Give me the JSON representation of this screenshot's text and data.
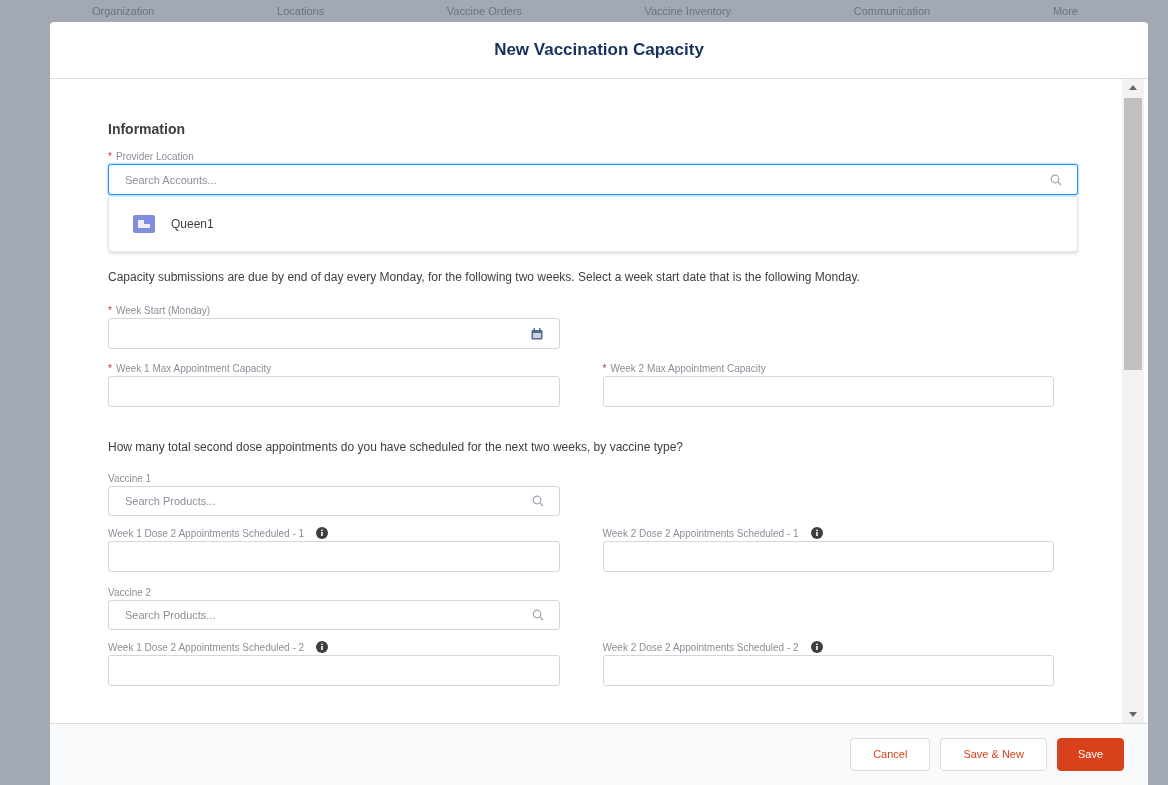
{
  "background_nav": [
    "Organization",
    "Locations",
    "Vaccine Orders",
    "Vaccine Inventory",
    "Communication",
    "More"
  ],
  "modal": {
    "title": "New Vaccination Capacity",
    "section_heading": "Information",
    "provider_location": {
      "mark": "*",
      "label": "Provider Location",
      "placeholder": "Search Accounts...",
      "focused": true,
      "options": [
        {
          "label": "Queen1"
        }
      ]
    },
    "note": "Capacity submissions are due by end of day every Monday, for the following two weeks. Select a week start date that is the following Monday.",
    "week_start": {
      "mark": "*",
      "label": "Week Start (Monday)"
    },
    "capacity_fields": [
      {
        "mark": "*",
        "label": "Week 1 Max Appointment Capacity"
      },
      {
        "mark": "*",
        "label": "Week 2 Max Appointment Capacity"
      }
    ],
    "question": "How many total second dose appointments do you have scheduled for the next two weeks, by vaccine type?",
    "vaccines": [
      {
        "label": "Vaccine 1",
        "placeholder": "Search Products...",
        "fields": [
          {
            "label": "Week 1 Dose 2 Appointments Scheduled - 1",
            "info": true
          },
          {
            "label": "Week 2 Dose 2 Appointments Scheduled - 1",
            "info": true
          }
        ]
      },
      {
        "label": "Vaccine 2",
        "placeholder": "Search Products...",
        "fields": [
          {
            "label": "Week 1 Dose 2 Appointments Scheduled - 2",
            "info": true
          },
          {
            "label": "Week 2 Dose 2 Appointments Scheduled - 2",
            "info": true
          }
        ]
      }
    ],
    "buttons": [
      {
        "label": "Cancel",
        "kind": "neutral"
      },
      {
        "label": "Save & New",
        "kind": "neutral"
      },
      {
        "label": "Save",
        "kind": "brand"
      }
    ]
  }
}
